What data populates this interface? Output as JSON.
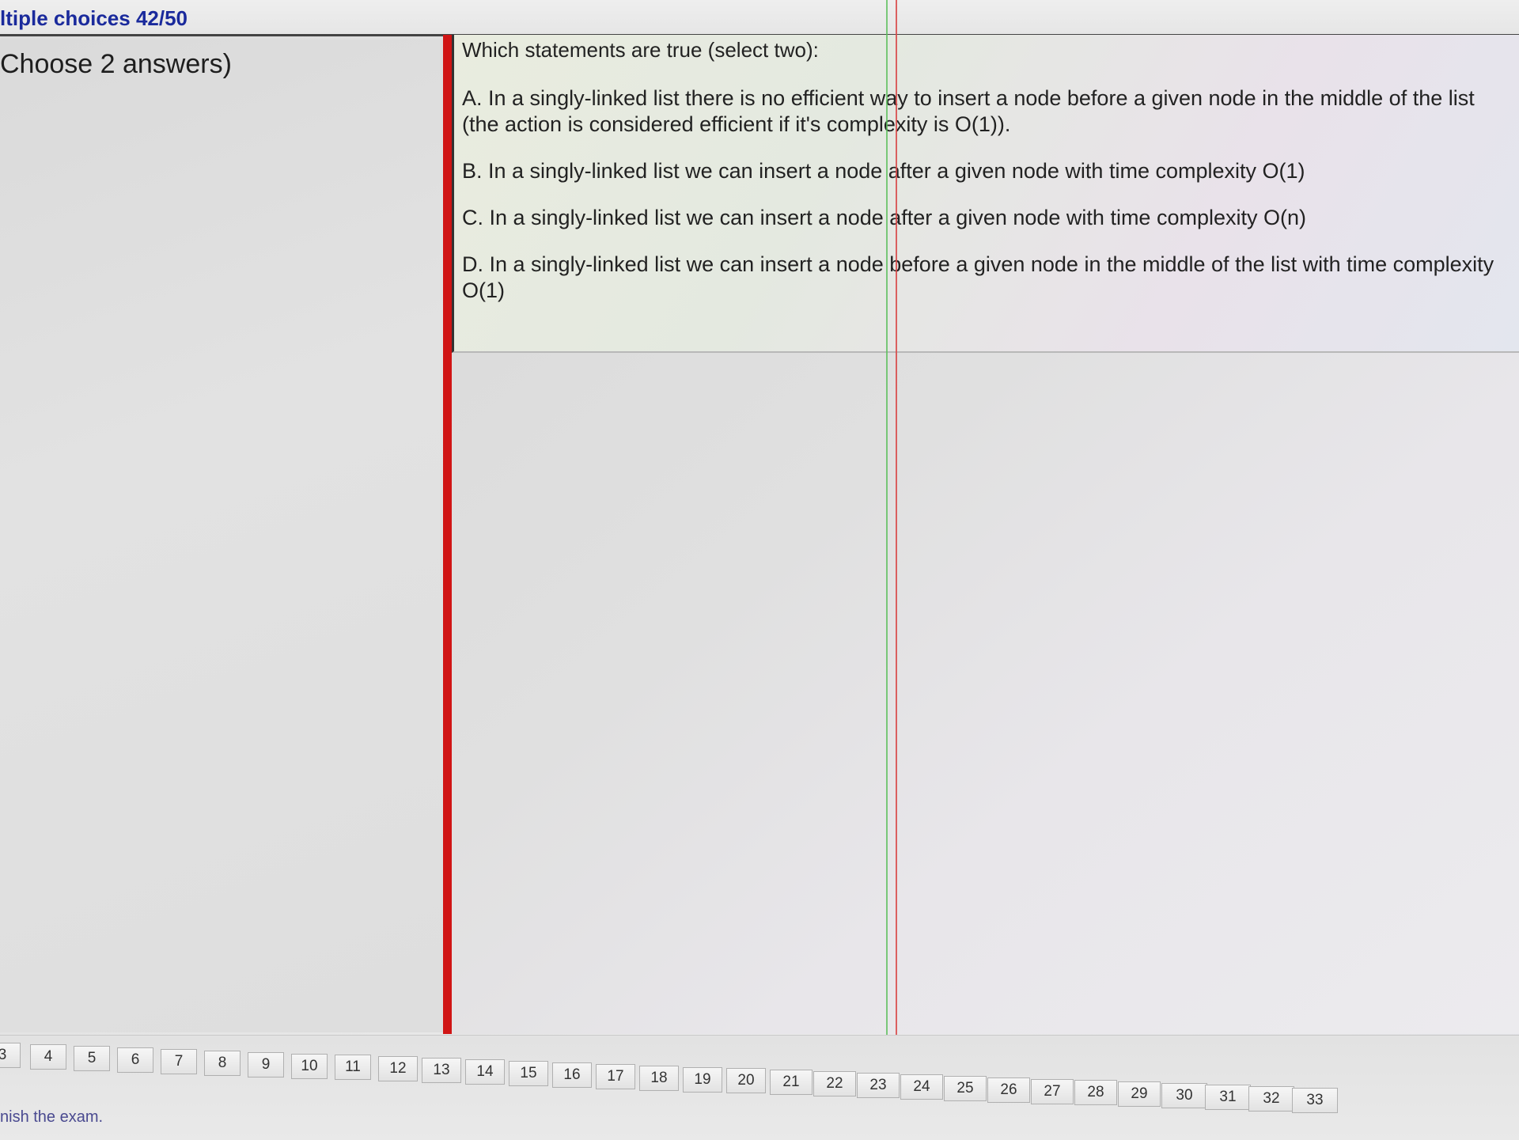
{
  "header": {
    "title": "ltiple choices 42/50"
  },
  "left_panel": {
    "instruction": "Choose 2 answers)"
  },
  "question": {
    "text": "Which statements are true (select two):",
    "options": [
      {
        "line1": "A.  In a singly-linked list there is no efficient way to insert a node before a given node in the middle of the list",
        "line2": "(the action is considered efficient if it's complexity is  O(1))."
      },
      {
        "line1": "B.  In a singly-linked list we can insert a node after a given node  with time complexity O(1)",
        "line2": ""
      },
      {
        "line1": "C.  In a singly-linked list  we can insert a node after a given node  with time complexity O(n)",
        "line2": ""
      },
      {
        "line1": "D.  In a singly-linked list  we can insert a node before a given node  in the middle of the list with time complexity",
        "line2": "O(1)"
      }
    ]
  },
  "navigator": {
    "question_numbers": [
      "3",
      "4",
      "5",
      "6",
      "7",
      "8",
      "9",
      "10",
      "11",
      "12",
      "13",
      "14",
      "15",
      "16",
      "17",
      "18",
      "19",
      "20",
      "21",
      "22",
      "23",
      "24",
      "25",
      "26",
      "27",
      "28",
      "29",
      "30",
      "31",
      "32",
      "33"
    ],
    "finish_label": "nish the exam."
  }
}
